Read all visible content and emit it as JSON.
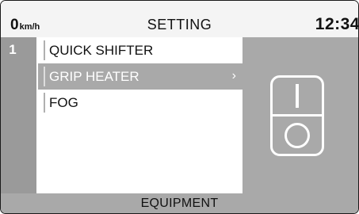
{
  "header": {
    "speed_value": "0",
    "speed_unit": "km/h",
    "title": "SETTING",
    "time": "12:34"
  },
  "page_number": "1",
  "menu": {
    "items": [
      {
        "label": "QUICK SHIFTER",
        "selected": false
      },
      {
        "label": "GRIP HEATER",
        "selected": true,
        "chevron": "›"
      },
      {
        "label": "FOG",
        "selected": false
      }
    ]
  },
  "preview": {
    "icon": "switch-icon"
  },
  "footer": {
    "label": "EQUIPMENT"
  },
  "colors": {
    "panel_gray": "#a9a9a9",
    "page_col_gray": "#9a9a9a",
    "text": "#111111",
    "highlight_text": "#ffffff"
  }
}
